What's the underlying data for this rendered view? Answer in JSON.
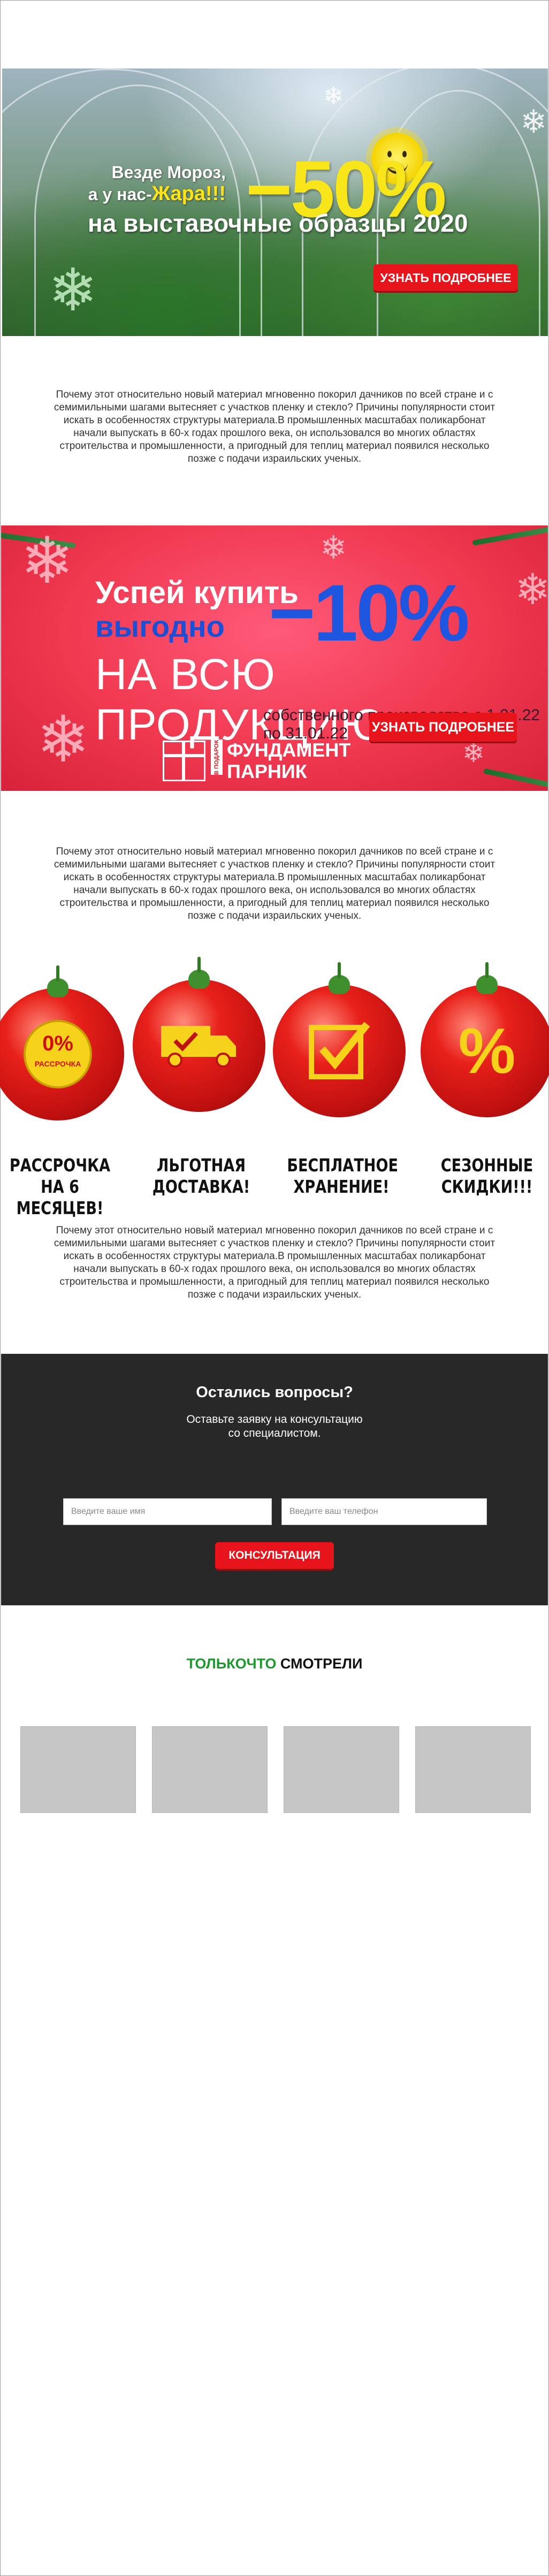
{
  "banner1": {
    "line1": "Везде Мороз,",
    "line2_prefix": "а у нас-",
    "line2_hot": "Жара!!!",
    "discount": "−50%",
    "subtitle": "на выставочные образцы 2020",
    "button": "УЗНАТЬ ПОДРОБНЕЕ"
  },
  "paragraphs": {
    "p1": "Почему этот относительно новый материал мгновенно покорил дачников по всей стране и с семимильными шагами вытесняет с участков пленку и стекло? Причины популярности стоит искать в особенностях структуры материала.В промышленных масштабах поликарбонат начали выпускать в 60-х годах прошлого века, он использовался во многих областях строительства и промышленности, а пригодный для теплиц материал появился несколько позже с подачи израильских ученых.",
    "p2": "Почему этот относительно новый материал мгновенно покорил дачников по всей стране и с семимильными шагами вытесняет с участков пленку и стекло? Причины популярности стоит искать в особенностях структуры материала.В промышленных масштабах поликарбонат начали выпускать в 60-х годах прошлого века, он использовался во многих областях строительства и промышленности, а пригодный для теплиц материал появился несколько позже с подачи израильских ученых.",
    "p3": "Почему этот относительно новый материал мгновенно покорил дачников по всей стране и с семимильными шагами вытесняет с участков пленку и стекло? Причины популярности стоит искать в особенностях структуры материала.В промышленных масштабах поликарбонат начали выпускать в 60-х годах прошлого века, он использовался во многих областях строительства и промышленности, а пригодный для теплиц материал появился несколько позже с подачи израильских ученых."
  },
  "banner2": {
    "line1": "Успей купить",
    "line2": "выгодно",
    "discount": "−10%",
    "line3": "НА ВСЮ ПРОДУКЦИЮ",
    "note": "собственного производства с 1.01.22 по 31.01.22",
    "gift_tag": "В ПОДАРОК",
    "gift_line1": "ФУНДАМЕНТ",
    "gift_line2": "ПАРНИК",
    "button": "УЗНАТЬ ПОДРОБНЕЕ"
  },
  "benefits": [
    {
      "line1": "РАССРОЧКА",
      "line2": "НА 6 МЕСЯЦЕВ!",
      "badge_pct": "0%",
      "badge_word": "РАССРОЧКА",
      "icon": "installment-badge-icon"
    },
    {
      "line1": "ЛЬГОТНАЯ",
      "line2": "ДОСТАВКА!",
      "icon": "delivery-truck-icon"
    },
    {
      "line1": "БЕСПЛАТНОЕ",
      "line2": "ХРАНЕНИЕ!",
      "icon": "checkbox-icon"
    },
    {
      "line1": "СЕЗОННЫЕ",
      "line2": "СКИДКИ!!!",
      "icon": "percent-icon",
      "symbol": "%"
    }
  ],
  "form": {
    "title": "Остались вопросы?",
    "subtitle_line1": "Оставьте заявку на консультацию",
    "subtitle_line2": "со специалистом.",
    "name_placeholder": "Введите ваше имя",
    "phone_placeholder": "Введите ваш телефон",
    "button": "КОНСУЛЬТАЦИЯ"
  },
  "recent": {
    "title_green": "ТОЛЬКОЧТО",
    "title_dark": " СМОТРЕЛИ",
    "cards_count": 4
  },
  "colors": {
    "accent_red": "#e8141c",
    "promo_yellow": "#f8e51a",
    "promo_blue": "#1f56e0",
    "form_bg": "#282828",
    "title_green": "#1a9a2a",
    "card_grey": "#c6c6c6"
  }
}
